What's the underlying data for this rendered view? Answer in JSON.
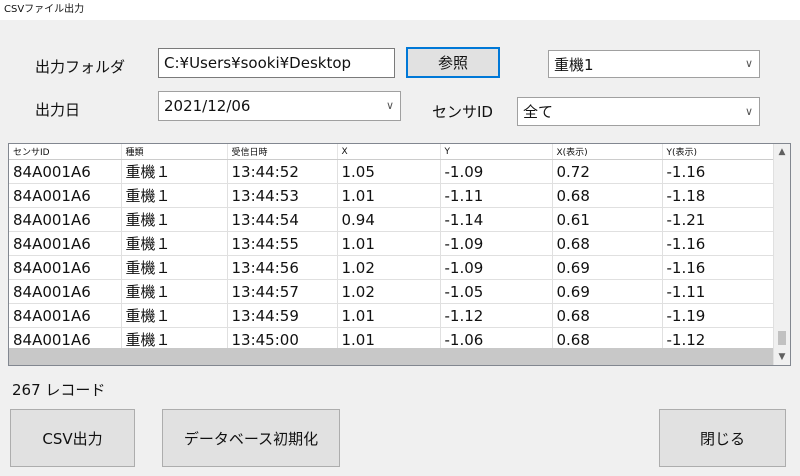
{
  "window": {
    "title": "CSVファイル出力"
  },
  "form": {
    "folder_label": "出力フォルダ",
    "folder_value": "C:¥Users¥sooki¥Desktop",
    "browse_button": "参照",
    "machine_select": "重機1",
    "date_label": "出力日",
    "date_value": "2021/12/06",
    "sensor_label": "センサID",
    "sensor_select": "全て"
  },
  "table": {
    "columns": [
      "センサID",
      "種類",
      "受信日時",
      "X",
      "Y",
      "X(表示)",
      "Y(表示)"
    ],
    "rows": [
      [
        "84A001A6",
        "重機１",
        "13:44:52",
        "1.05",
        "-1.09",
        "0.72",
        "-1.16"
      ],
      [
        "84A001A6",
        "重機１",
        "13:44:53",
        "1.01",
        "-1.11",
        "0.68",
        "-1.18"
      ],
      [
        "84A001A6",
        "重機１",
        "13:44:54",
        "0.94",
        "-1.14",
        "0.61",
        "-1.21"
      ],
      [
        "84A001A6",
        "重機１",
        "13:44:55",
        "1.01",
        "-1.09",
        "0.68",
        "-1.16"
      ],
      [
        "84A001A6",
        "重機１",
        "13:44:56",
        "1.02",
        "-1.09",
        "0.69",
        "-1.16"
      ],
      [
        "84A001A6",
        "重機１",
        "13:44:57",
        "1.02",
        "-1.05",
        "0.69",
        "-1.11"
      ],
      [
        "84A001A6",
        "重機１",
        "13:44:59",
        "1.01",
        "-1.12",
        "0.68",
        "-1.19"
      ],
      [
        "84A001A6",
        "重機１",
        "13:45:00",
        "1.01",
        "-1.06",
        "0.68",
        "-1.12"
      ]
    ]
  },
  "record_count": "267 レコード",
  "buttons": {
    "csv_export": "CSV出力",
    "db_init": "データベース初期化",
    "close": "閉じる"
  },
  "icons": {
    "chevron": "chevron-down-icon",
    "scroll_up": "scroll-up-icon",
    "scroll_down": "scroll-down-icon"
  }
}
